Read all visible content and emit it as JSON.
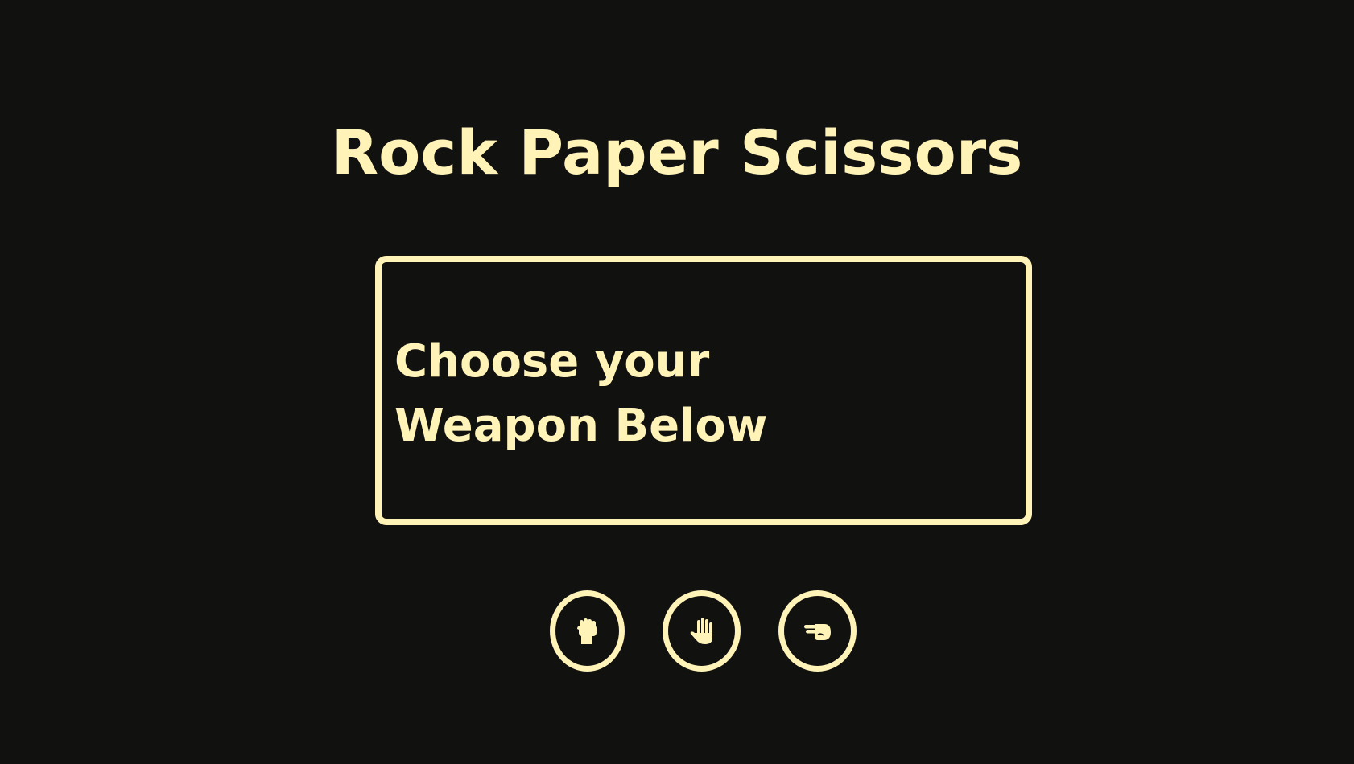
{
  "game": {
    "title": "Rock Paper Scissors",
    "message": "Choose your Weapon Below"
  },
  "weapons": [
    {
      "id": "rock",
      "icon": "rock-fist-icon"
    },
    {
      "id": "paper",
      "icon": "paper-hand-icon"
    },
    {
      "id": "scissors",
      "icon": "scissors-hand-icon"
    }
  ],
  "colors": {
    "background": "#111110",
    "accent": "#fff3b8"
  }
}
